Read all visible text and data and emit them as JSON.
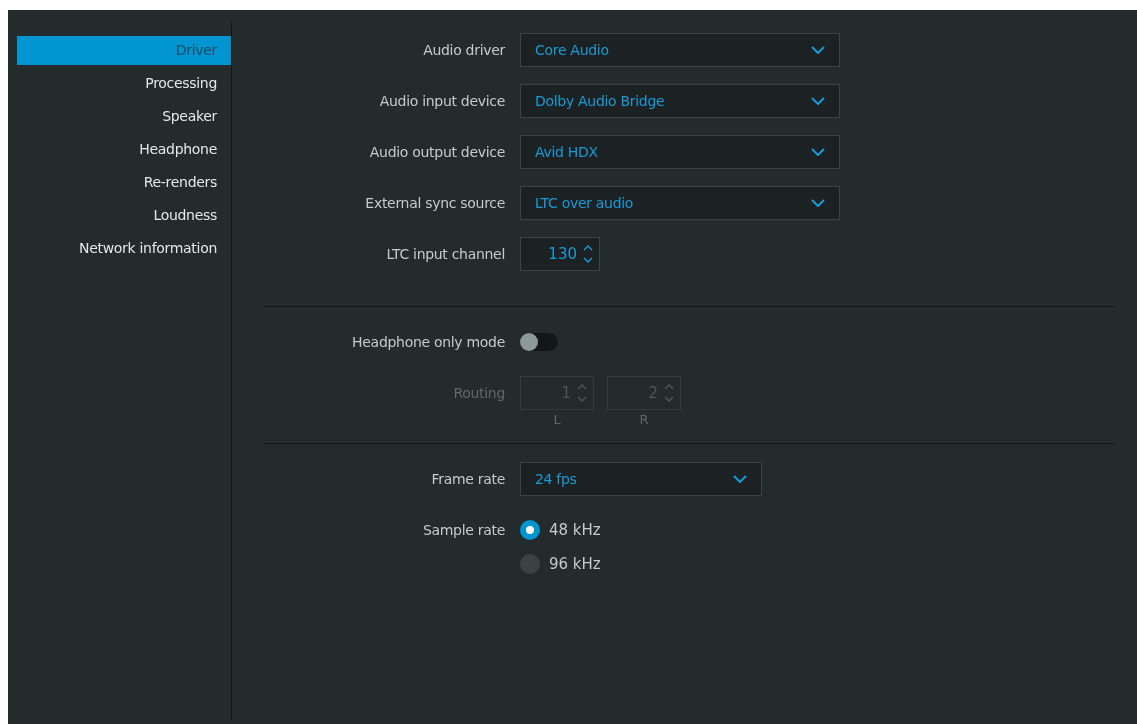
{
  "sidebar": {
    "items": [
      {
        "label": "Driver",
        "selected": true
      },
      {
        "label": "Processing",
        "selected": false
      },
      {
        "label": "Speaker",
        "selected": false
      },
      {
        "label": "Headphone",
        "selected": false
      },
      {
        "label": "Re-renders",
        "selected": false
      },
      {
        "label": "Loudness",
        "selected": false
      },
      {
        "label": "Network information",
        "selected": false
      }
    ]
  },
  "sections": [
    {
      "rows": [
        {
          "kind": "dropdown",
          "label": "Audio driver",
          "value": "Core Audio"
        },
        {
          "kind": "dropdown",
          "label": "Audio input device",
          "value": "Dolby Audio Bridge"
        },
        {
          "kind": "dropdown",
          "label": "Audio output device",
          "value": "Avid HDX"
        },
        {
          "kind": "dropdown",
          "label": "External sync source",
          "value": "LTC over audio"
        },
        {
          "kind": "spinner",
          "label": "LTC input channel",
          "value": "130"
        }
      ]
    },
    {
      "rows": [
        {
          "kind": "toggle",
          "label": "Headphone only mode",
          "on": false
        },
        {
          "kind": "routing",
          "label": "Routing",
          "disabled": true,
          "fields": [
            {
              "value": "1",
              "caption": "L"
            },
            {
              "value": "2",
              "caption": "R"
            }
          ]
        }
      ]
    },
    {
      "rows": [
        {
          "kind": "dropdown",
          "label": "Frame rate",
          "value": "24 fps",
          "narrow": true
        },
        {
          "kind": "radio",
          "label": "Sample rate",
          "options": [
            {
              "label": "48 kHz",
              "selected": true
            },
            {
              "label": "96 kHz",
              "selected": false
            }
          ]
        }
      ]
    }
  ]
}
